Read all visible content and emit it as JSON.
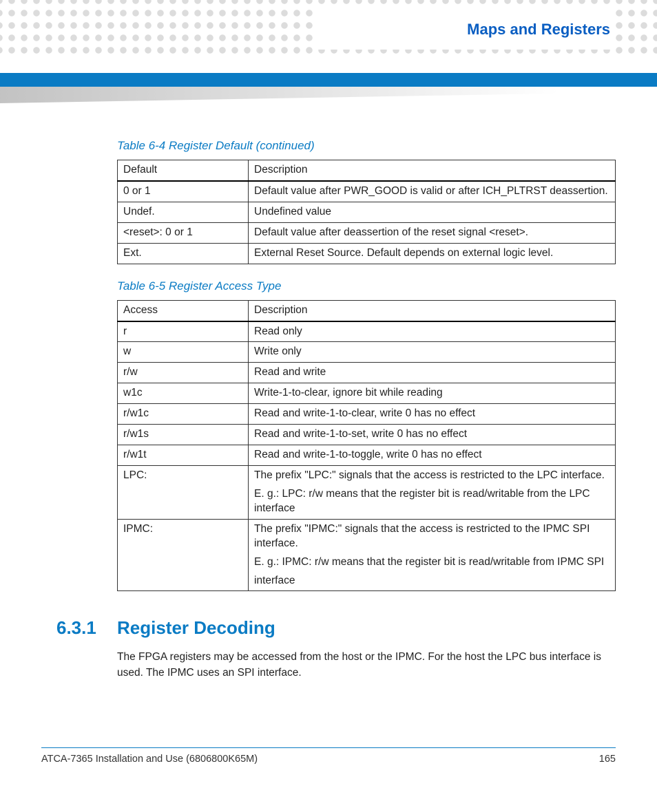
{
  "header": {
    "title": "Maps and Registers"
  },
  "table64": {
    "caption": "Table 6-4 Register Default (continued)",
    "head": [
      "Default",
      "Description"
    ],
    "rows": [
      [
        "0 or 1",
        "Default value after PWR_GOOD is valid or after ICH_PLTRST deassertion."
      ],
      [
        "Undef.",
        "Undefined value"
      ],
      [
        "<reset>: 0 or 1",
        "Default value after deassertion of the reset signal <reset>."
      ],
      [
        "Ext.",
        "External Reset Source. Default depends on external logic level."
      ]
    ]
  },
  "table65": {
    "caption": "Table 6-5 Register Access Type",
    "head": [
      "Access",
      "Description"
    ],
    "rows": [
      [
        "r",
        "Read only"
      ],
      [
        "w",
        "Write only"
      ],
      [
        "r/w",
        "Read and write"
      ],
      [
        "w1c",
        "Write-1-to-clear, ignore bit while reading"
      ],
      [
        "r/w1c",
        "Read and write-1-to-clear, write 0 has no effect"
      ],
      [
        "r/w1s",
        "Read and write-1-to-set, write 0 has no effect"
      ],
      [
        "r/w1t",
        "Read and write-1-to-toggle, write 0 has no effect"
      ]
    ],
    "row_lpc": {
      "c0": "LPC:",
      "lines": [
        "The prefix \"LPC:\" signals that the access is restricted to the LPC interface.",
        "E. g.: LPC: r/w means that the register bit is read/writable from the LPC interface"
      ]
    },
    "row_ipmc": {
      "c0": "IPMC:",
      "lines": [
        "The prefix \"IPMC:\" signals that the access is restricted to the IPMC SPI interface.",
        "E. g.: IPMC: r/w means that the register bit is read/writable from IPMC SPI",
        "interface"
      ]
    }
  },
  "section": {
    "num": "6.3.1",
    "title": "Register Decoding",
    "para": "The FPGA registers may be accessed from the host or the IPMC. For the host the LPC bus interface is used. The IPMC uses an SPI interface."
  },
  "footer": {
    "left": "ATCA-7365 Installation and Use (6806800K65M)",
    "right": "165"
  }
}
